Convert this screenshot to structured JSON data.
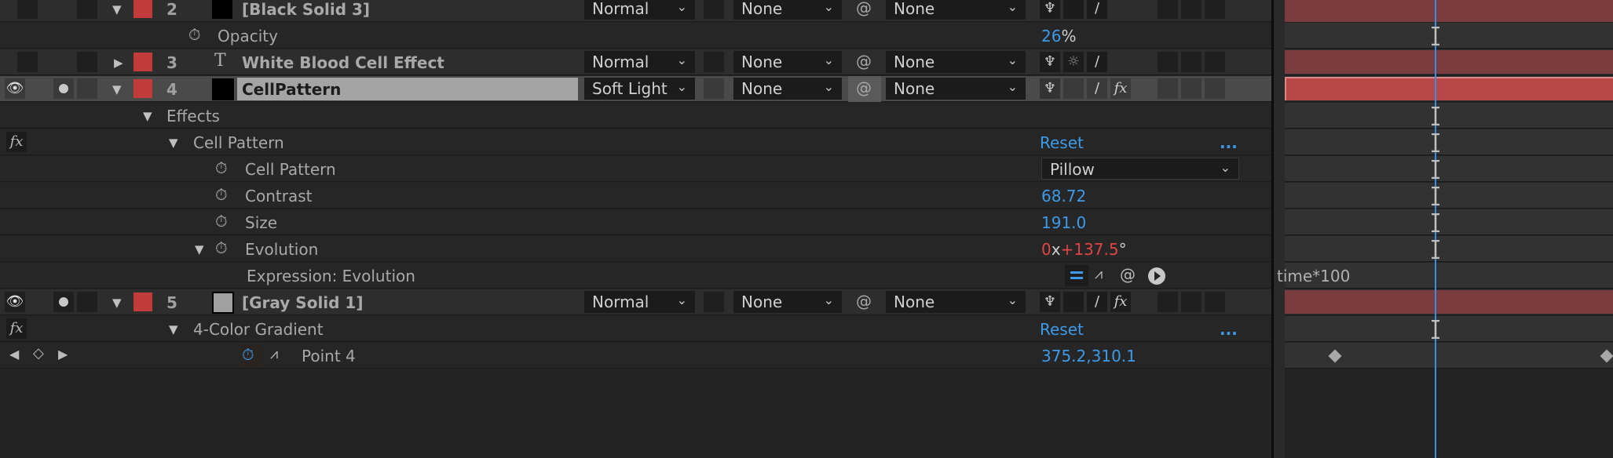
{
  "layers": [
    {
      "num": "2",
      "name": "[Black Solid 3]",
      "mode": "Normal",
      "trkmat": "None",
      "parent": "None",
      "source_color": "#000000"
    },
    {
      "num": "3",
      "name": "White Blood Cell Effect",
      "mode": "Normal",
      "trkmat": "None",
      "parent": "None",
      "type": "text"
    },
    {
      "num": "4",
      "name": "CellPattern",
      "mode": "Soft Light",
      "trkmat": "None",
      "parent": "None",
      "source_color": "#000000",
      "selected": true
    },
    {
      "num": "5",
      "name": "[Gray Solid 1]",
      "mode": "Normal",
      "trkmat": "None",
      "parent": "None",
      "source_color": "#a0a0a0"
    }
  ],
  "opacity": {
    "label": "Opacity",
    "value": "26",
    "unit": "%"
  },
  "effects_group": "Effects",
  "cell_pattern_effect": {
    "name": "Cell Pattern",
    "reset": "Reset",
    "more": "...",
    "props": [
      {
        "label": "Cell Pattern",
        "value": "Pillow"
      },
      {
        "label": "Contrast",
        "value": "68.72"
      },
      {
        "label": "Size",
        "value": "191.0"
      },
      {
        "label": "Evolution",
        "rev": "0",
        "x": "x",
        "deg": "+137.5",
        "deg_sym": "°"
      }
    ],
    "expression_label": "Expression: Evolution",
    "expression": "time*100"
  },
  "gradient_effect": {
    "name": "4-Color Gradient",
    "reset": "Reset",
    "more": "...",
    "point_label": "Point 4",
    "point_x": "375.2",
    "sep": ",",
    "point_y": "310.1"
  },
  "colors": {
    "accent": "#3d9ae8",
    "label_red": "#c23b3b",
    "layer_bar": "#7a3c3c",
    "layer_bar_selected": "#b84848",
    "playhead": "#3a8de0"
  }
}
